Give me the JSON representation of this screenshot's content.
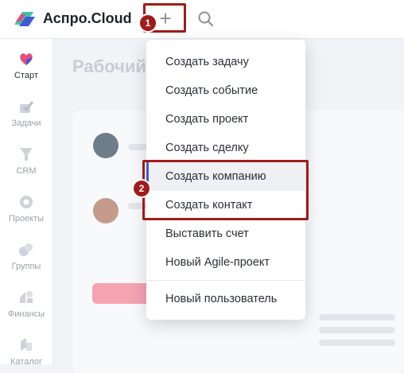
{
  "header": {
    "brand": "Аспро.Cloud",
    "plus_icon": "plus-icon",
    "search_icon": "search-icon"
  },
  "sidebar": {
    "items": [
      {
        "label": "Старт",
        "icon": "start-icon",
        "active": true
      },
      {
        "label": "Задачи",
        "icon": "tasks-icon"
      },
      {
        "label": "CRM",
        "icon": "crm-icon"
      },
      {
        "label": "Проекты",
        "icon": "projects-icon"
      },
      {
        "label": "Группы",
        "icon": "groups-icon"
      },
      {
        "label": "Финансы",
        "icon": "finance-icon"
      },
      {
        "label": "Каталог",
        "icon": "catalog-icon"
      }
    ]
  },
  "content": {
    "page_title": "Рабочий"
  },
  "menu": {
    "items": [
      {
        "label": "Создать задачу"
      },
      {
        "label": "Создать событие"
      },
      {
        "label": "Создать проект"
      },
      {
        "label": "Создать сделку"
      },
      {
        "label": "Создать компанию",
        "hovered": true
      },
      {
        "label": "Создать контакт"
      },
      {
        "label": "Выставить счет"
      },
      {
        "label": "Новый Agile-проект"
      },
      {
        "label": "Новый пользователь"
      }
    ]
  },
  "annotations": {
    "step1": "1",
    "step2": "2",
    "color": "#a01b1b"
  },
  "colors": {
    "accent": "#3e5bd6",
    "highlight": "#a01b1b"
  }
}
